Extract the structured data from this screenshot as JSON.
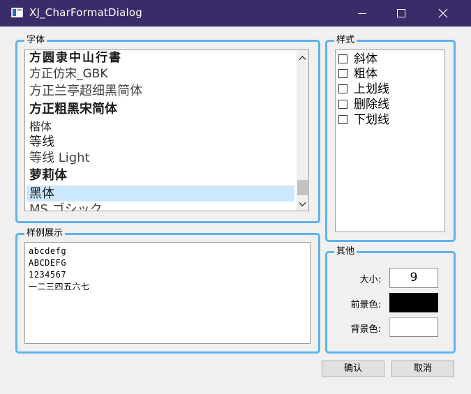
{
  "window": {
    "title": "XJ_CharFormatDialog"
  },
  "groups": {
    "font": {
      "title": "字体"
    },
    "style": {
      "title": "样式"
    },
    "sample": {
      "title": "样例展示"
    },
    "other": {
      "title": "其他"
    }
  },
  "font_list": {
    "items": [
      "方圆隶中山行書",
      "方正仿宋_GBK",
      "方正兰亭超细黑简体",
      "方正粗黑宋简体",
      "楷体",
      "等线",
      "等线 Light",
      "萝莉体",
      "黑体",
      "MS ゴシック"
    ],
    "selected": "黑体"
  },
  "styles": [
    {
      "label": "斜体",
      "checked": false
    },
    {
      "label": "粗体",
      "checked": false
    },
    {
      "label": "上划线",
      "checked": false
    },
    {
      "label": "删除线",
      "checked": false
    },
    {
      "label": "下划线",
      "checked": false
    }
  ],
  "sample": {
    "lines": [
      "abcdefg",
      "ABCDEFG",
      "1234567",
      "一二三四五六七"
    ]
  },
  "other": {
    "size_label": "大小:",
    "size_value": "9",
    "fg_label": "前景色:",
    "fg_color": "#000000",
    "bg_label": "背景色:",
    "bg_color": "#ffffff"
  },
  "buttons": {
    "ok": "确认",
    "cancel": "取消"
  },
  "colors": {
    "titlebar": "#3a2c68",
    "group_border": "#5eb3ef",
    "selection": "#cce8ff"
  }
}
